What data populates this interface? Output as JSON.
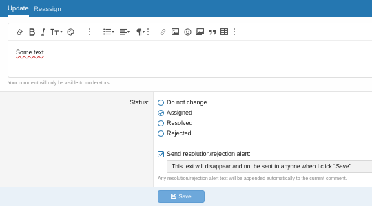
{
  "tabs": [
    {
      "label": "Update",
      "active": true
    },
    {
      "label": "Reassign",
      "active": false
    }
  ],
  "editor": {
    "content": "Some text",
    "toolbar_icons": [
      "eraser-icon",
      "bold-icon",
      "italic-icon",
      "text-size-icon",
      "palette-icon",
      "more-icon",
      "list-icon",
      "align-icon",
      "paragraph-icon",
      "more-icon",
      "link-icon",
      "image-icon",
      "smiley-icon",
      "media-icon",
      "quote-icon",
      "table-icon",
      "more-icon"
    ]
  },
  "upper_hint": "Your comment will only be visible to moderators.",
  "status": {
    "label": "Status:",
    "options": [
      {
        "label": "Do not change",
        "checked": false
      },
      {
        "label": "Assigned",
        "checked": true
      },
      {
        "label": "Resolved",
        "checked": false
      },
      {
        "label": "Rejected",
        "checked": false
      }
    ]
  },
  "alert": {
    "label": "Send resolution/rejection alert:",
    "checked": true,
    "input_value": "This text will disappear and not be sent to anyone when I click \"Save\"",
    "hint": "Any resolution/rejection alert text will be appended automatically to the current comment."
  },
  "save_label": "Save",
  "colors": {
    "accent": "#2577b1",
    "button": "#6da8db",
    "footer": "#e9f1f8"
  }
}
